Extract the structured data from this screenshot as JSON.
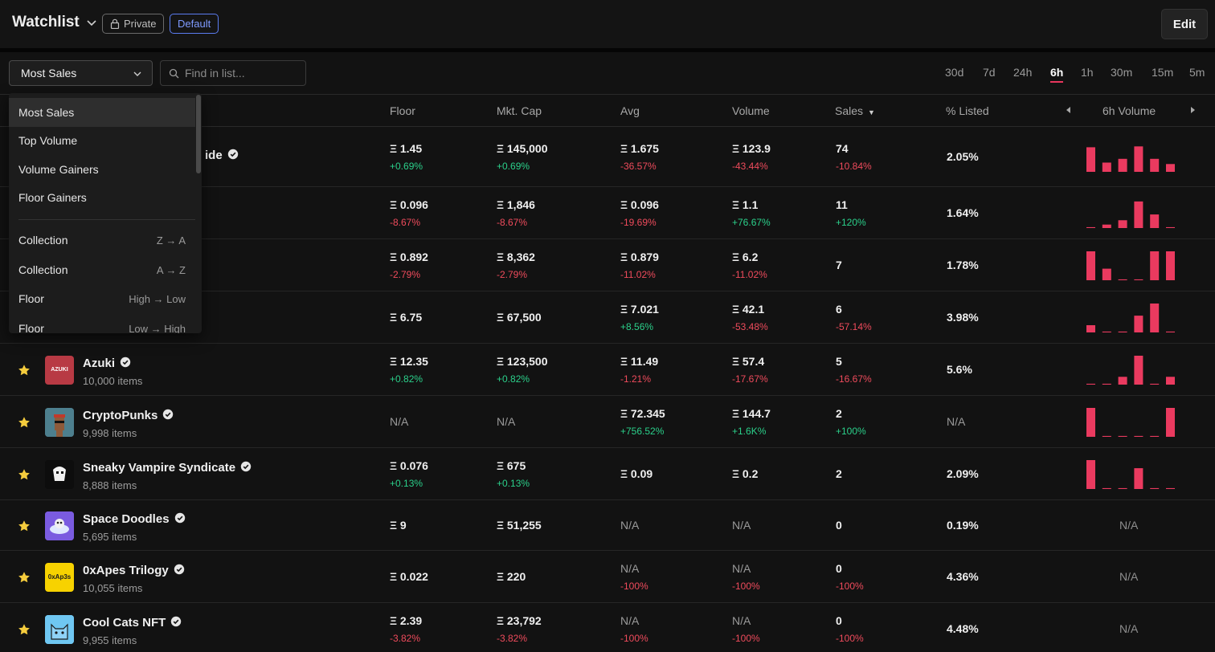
{
  "header": {
    "title": "Watchlist",
    "private_label": "Private",
    "default_label": "Default",
    "edit_label": "Edit"
  },
  "toolbar": {
    "sort_selected": "Most Sales",
    "search_placeholder": "Find in list...",
    "time_tabs": [
      "30d",
      "7d",
      "24h",
      "6h",
      "1h",
      "30m",
      "15m",
      "5m"
    ],
    "active_tab": "6h"
  },
  "table": {
    "columns": {
      "floor": "Floor",
      "mktcap": "Mkt. Cap",
      "avg": "Avg",
      "volume": "Volume",
      "sales": "Sales",
      "listed": "% Listed",
      "volume_chart": "6h Volume"
    },
    "rows": [
      {
        "name": "ide",
        "items": "",
        "floor": "Ξ 1.45",
        "floor_chg": "+0.69%",
        "mktcap": "Ξ 145,000",
        "mktcap_chg": "+0.69%",
        "avg": "Ξ 1.675",
        "avg_chg": "-36.57%",
        "volume": "Ξ 123.9",
        "volume_chg": "-43.44%",
        "sales": "74",
        "sales_chg": "-10.84%",
        "listed": "2.05%",
        "bars": [
          0.85,
          0.32,
          0.45,
          0.88,
          0.45,
          0.27
        ],
        "na_chart": ""
      },
      {
        "name": "",
        "items": "",
        "floor": "Ξ 0.096",
        "floor_chg": "-8.67%",
        "mktcap": "Ξ 1,846",
        "mktcap_chg": "-8.67%",
        "avg": "Ξ 0.096",
        "avg_chg": "-19.69%",
        "volume": "Ξ 1.1",
        "volume_chg": "+76.67%",
        "sales": "11",
        "sales_chg": "+120%",
        "listed": "1.64%",
        "bars": [
          0.03,
          0.12,
          0.27,
          0.92,
          0.47,
          0.03
        ],
        "na_chart": ""
      },
      {
        "name": "",
        "items": "",
        "floor": "Ξ 0.892",
        "floor_chg": "-2.79%",
        "mktcap": "Ξ 8,362",
        "mktcap_chg": "-2.79%",
        "avg": "Ξ 0.879",
        "avg_chg": "-11.02%",
        "volume": "Ξ 6.2",
        "volume_chg": "-11.02%",
        "sales": "7",
        "sales_chg": "",
        "listed": "1.78%",
        "bars": [
          1.0,
          0.4,
          0.03,
          0.03,
          1.0,
          1.0
        ],
        "na_chart": ""
      },
      {
        "name": "",
        "items": "",
        "floor": "Ξ 6.75",
        "floor_chg": "",
        "mktcap": "Ξ 67,500",
        "mktcap_chg": "",
        "avg": "Ξ 7.021",
        "avg_chg": "+8.56%",
        "volume": "Ξ 42.1",
        "volume_chg": "-53.48%",
        "sales": "6",
        "sales_chg": "-57.14%",
        "listed": "3.98%",
        "bars": [
          0.25,
          0.03,
          0.03,
          0.58,
          1.0,
          0.03
        ],
        "na_chart": ""
      },
      {
        "name": "Azuki",
        "items": "10,000 items",
        "floor": "Ξ 12.35",
        "floor_chg": "+0.82%",
        "mktcap": "Ξ 123,500",
        "mktcap_chg": "+0.82%",
        "avg": "Ξ 11.49",
        "avg_chg": "-1.21%",
        "volume": "Ξ 57.4",
        "volume_chg": "-17.67%",
        "sales": "5",
        "sales_chg": "-16.67%",
        "listed": "5.6%",
        "bars": [
          0.03,
          0.03,
          0.27,
          1.0,
          0.03,
          0.27
        ],
        "na_chart": ""
      },
      {
        "name": "CryptoPunks",
        "items": "9,998 items",
        "floor": "N/A",
        "floor_chg": "",
        "mktcap": "N/A",
        "mktcap_chg": "",
        "avg": "Ξ 72.345",
        "avg_chg": "+756.52%",
        "volume": "Ξ 144.7",
        "volume_chg": "+1.6K%",
        "sales": "2",
        "sales_chg": "+100%",
        "listed": "N/A",
        "bars": [
          1.0,
          0.03,
          0.03,
          0.03,
          0.03,
          1.0
        ],
        "na_chart": ""
      },
      {
        "name": "Sneaky Vampire Syndicate",
        "items": "8,888 items",
        "floor": "Ξ 0.076",
        "floor_chg": "+0.13%",
        "mktcap": "Ξ 675",
        "mktcap_chg": "+0.13%",
        "avg": "Ξ 0.09",
        "avg_chg": "",
        "volume": "Ξ 0.2",
        "volume_chg": "",
        "sales": "2",
        "sales_chg": "",
        "listed": "2.09%",
        "bars": [
          1.0,
          0.03,
          0.03,
          0.72,
          0.03,
          0.03
        ],
        "na_chart": ""
      },
      {
        "name": "Space Doodles",
        "items": "5,695 items",
        "floor": "Ξ 9",
        "floor_chg": "",
        "mktcap": "Ξ 51,255",
        "mktcap_chg": "",
        "avg": "N/A",
        "avg_chg": "",
        "volume": "N/A",
        "volume_chg": "",
        "sales": "0",
        "sales_chg": "",
        "listed": "0.19%",
        "bars": [],
        "na_chart": "N/A"
      },
      {
        "name": "0xApes Trilogy",
        "items": "10,055 items",
        "floor": "Ξ 0.022",
        "floor_chg": "",
        "mktcap": "Ξ 220",
        "mktcap_chg": "",
        "avg": "N/A",
        "avg_chg": "-100%",
        "volume": "N/A",
        "volume_chg": "-100%",
        "sales": "0",
        "sales_chg": "-100%",
        "listed": "4.36%",
        "bars": [],
        "na_chart": "N/A"
      },
      {
        "name": "Cool Cats NFT",
        "items": "9,955 items",
        "floor": "Ξ 2.39",
        "floor_chg": "-3.82%",
        "mktcap": "Ξ 23,792",
        "mktcap_chg": "-3.82%",
        "avg": "N/A",
        "avg_chg": "-100%",
        "volume": "N/A",
        "volume_chg": "-100%",
        "sales": "0",
        "sales_chg": "-100%",
        "listed": "4.48%",
        "bars": [],
        "na_chart": "N/A"
      }
    ]
  },
  "thumbs": {
    "azuki_text": "AZUKI",
    "apes_text": "0xAp3s"
  },
  "dropdown": {
    "items": [
      {
        "label": "Most Sales",
        "dir": ""
      },
      {
        "label": "Top Volume",
        "dir": ""
      },
      {
        "label": "Volume Gainers",
        "dir": ""
      },
      {
        "label": "Floor Gainers",
        "dir": ""
      },
      {
        "label": "Collection",
        "dir": "Z → A"
      },
      {
        "label": "Collection",
        "dir": "A → Z"
      },
      {
        "label": "Floor",
        "dir": "High → Low"
      },
      {
        "label": "Floor",
        "dir": "Low → High"
      }
    ]
  },
  "colors": {
    "accent": "#e8365d",
    "up": "#2bd18b",
    "down": "#ef4b5c",
    "star": "#f5cc3d",
    "bar": "#ea3a5f"
  }
}
